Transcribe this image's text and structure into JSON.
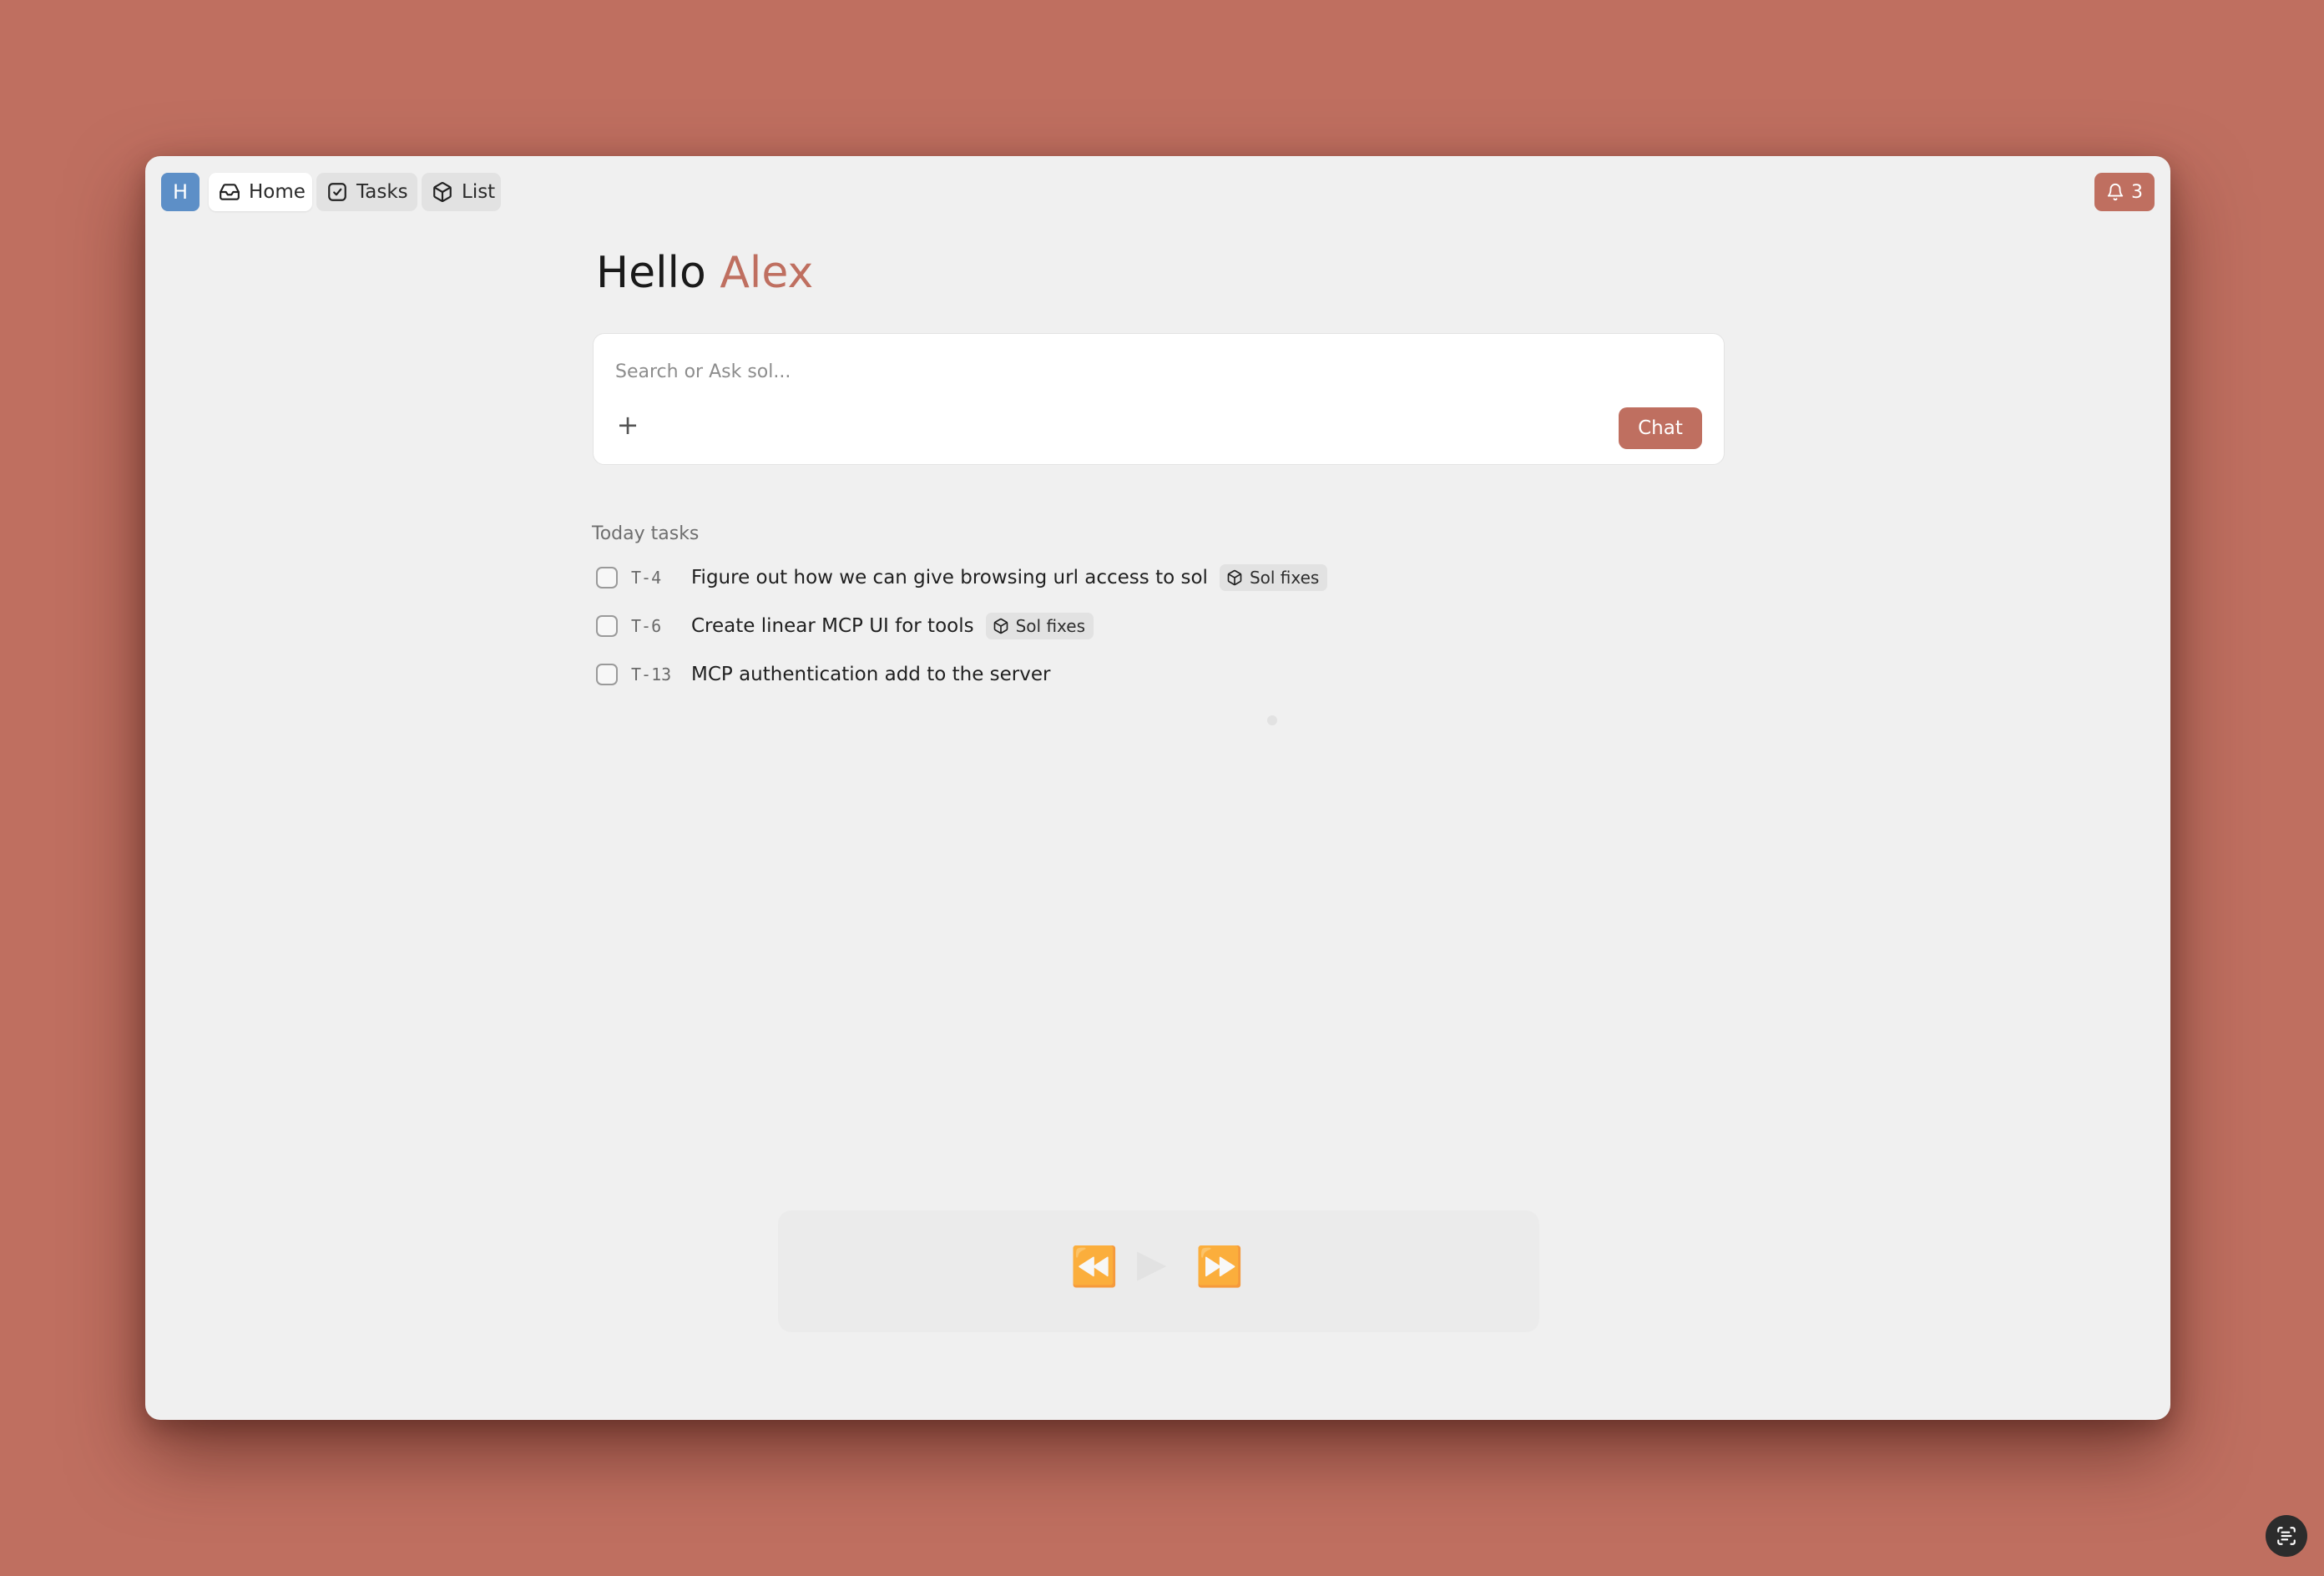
{
  "header": {
    "avatar_letter": "H",
    "tabs": [
      {
        "label": "Home",
        "icon": "inbox-icon",
        "active": true
      },
      {
        "label": "Tasks",
        "icon": "check-square-icon",
        "active": false
      },
      {
        "label": "List",
        "icon": "box-icon",
        "active": false
      }
    ],
    "notifications": {
      "count": "3",
      "icon": "bell-icon"
    }
  },
  "greeting": {
    "prefix": "Hello",
    "name": "Alex"
  },
  "search": {
    "placeholder": "Search or Ask sol...",
    "add_label": "+",
    "chat_label": "Chat"
  },
  "today_tasks": {
    "label": "Today tasks",
    "items": [
      {
        "id": "T-4",
        "title": "Figure out how we can give browsing url access to sol",
        "tag": "Sol fixes",
        "done": false
      },
      {
        "id": "T-6",
        "title": "Create linear MCP UI for tools",
        "tag": "Sol fixes",
        "done": false
      },
      {
        "id": "T-13",
        "title": "MCP authentication add to the server",
        "tag": "",
        "done": false
      }
    ]
  },
  "colors": {
    "background": "#bf6f60",
    "accent": "#bf6f60",
    "avatar": "#5d8fc7",
    "window": "#f0f0f0"
  }
}
